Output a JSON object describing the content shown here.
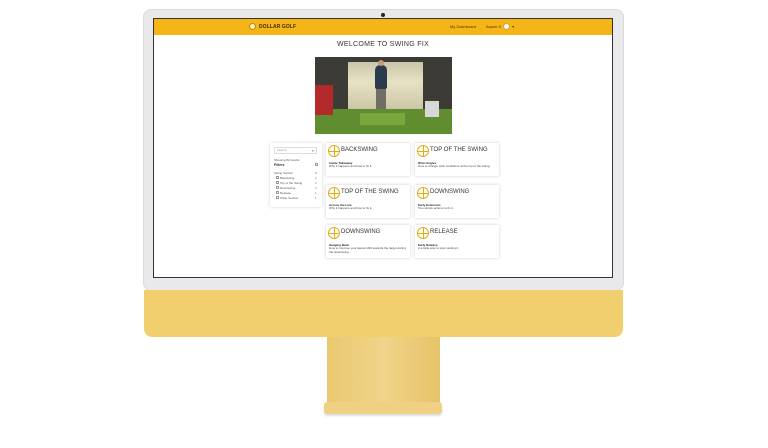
{
  "site": {
    "brand": "DOLLAR GOLF",
    "nav_dashboard": "My Dashboard",
    "user_name": "Aspen S",
    "user_caret": "▾",
    "page_title": "WELCOME TO SWING FIX"
  },
  "sidebar": {
    "search_placeholder": "Search",
    "search_icon": "⌕",
    "results_label": "Showing 82 results",
    "filters_label": "Filters",
    "group_label": "Swing Section",
    "group_count": "8",
    "items": [
      {
        "label": "Backswing",
        "count": "2"
      },
      {
        "label": "Top of the Swing",
        "count": "2"
      },
      {
        "label": "Downswing",
        "count": "2"
      },
      {
        "label": "Release",
        "count": "1"
      },
      {
        "label": "Other Section",
        "count": "1"
      }
    ]
  },
  "cards": [
    {
      "title": "BACKSWING",
      "subtitle": "Inside Takeaway",
      "desc": "Why it happens and how to fix it."
    },
    {
      "title": "TOP OF THE SWING",
      "subtitle": "Wrist Angles",
      "desc": "How to change wrist conditions at the top of the swing."
    },
    {
      "title": "TOP OF THE SWING",
      "subtitle": "Across the Line",
      "desc": "Why it happens and how to fix it."
    },
    {
      "title": "DOWNSWING",
      "subtitle": "Early Extension",
      "desc": "Two simple actions to fix it."
    },
    {
      "title": "DOWNSWING",
      "subtitle": "Hanging Back",
      "desc": "How to improve your lateral shift towards the target during the downswing."
    },
    {
      "title": "RELEASE",
      "subtitle": "Early Release",
      "desc": "A simple way to stop casting it."
    }
  ],
  "colors": {
    "accent": "#f6b517",
    "icon": "#e3ac15",
    "chin": "#f2cf6e"
  }
}
